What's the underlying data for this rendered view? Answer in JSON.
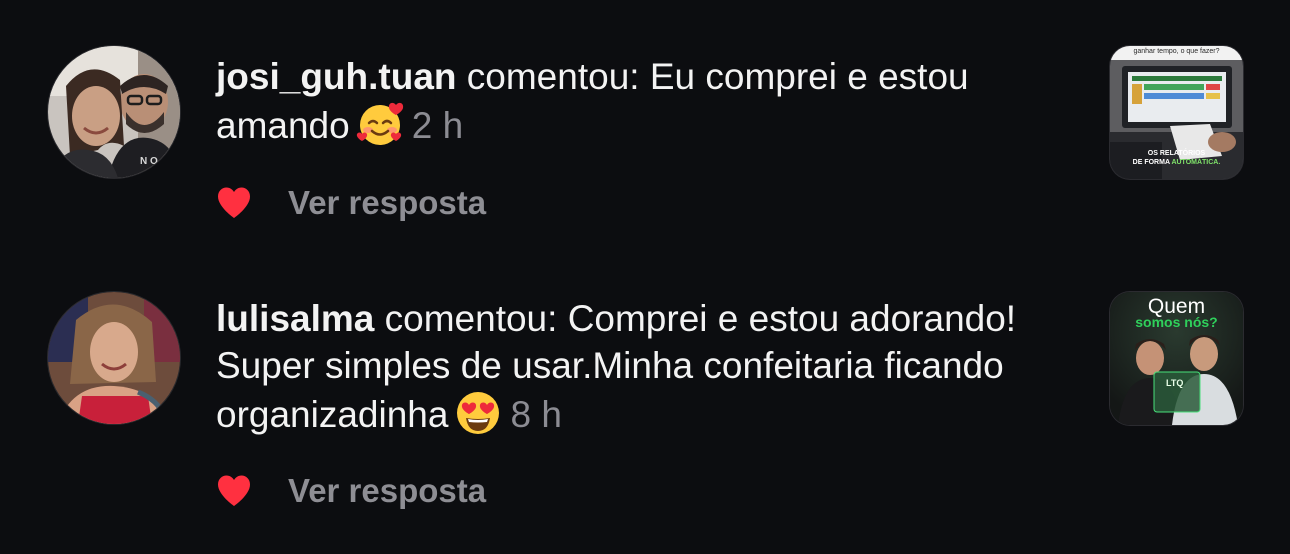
{
  "notifications": [
    {
      "username": "josi_guh.tuan",
      "message": "comentou: Eu comprei e estou amando",
      "emoji": "smiling-face-with-hearts",
      "time": "2 h",
      "liked": true,
      "reply_label": "Ver resposta",
      "thumbnail": {
        "top_text": "ganhar tempo, o que fazer?",
        "bottom_text_1": "OS RELATÓRIOS",
        "bottom_text_2": "DE FORMA",
        "bottom_text_accent": "AUTOMÁTICA."
      }
    },
    {
      "username": "lulisalma",
      "message": "comentou: Comprei e estou adorando! Super simples de usar.Minha confeitaria ficando organizadinha",
      "emoji": "smiling-face-with-heart-eyes",
      "time": "8 h",
      "liked": true,
      "reply_label": "Ver resposta",
      "thumbnail": {
        "title": "Quem",
        "subtitle": "somos nós?",
        "logo_text": "LTQ"
      }
    }
  ],
  "colors": {
    "background": "#0c0d10",
    "text": "#f3f3f3",
    "secondary_text": "#8c8c93",
    "heart": "#ff3040",
    "thumb_accent": "#2fd05b"
  }
}
